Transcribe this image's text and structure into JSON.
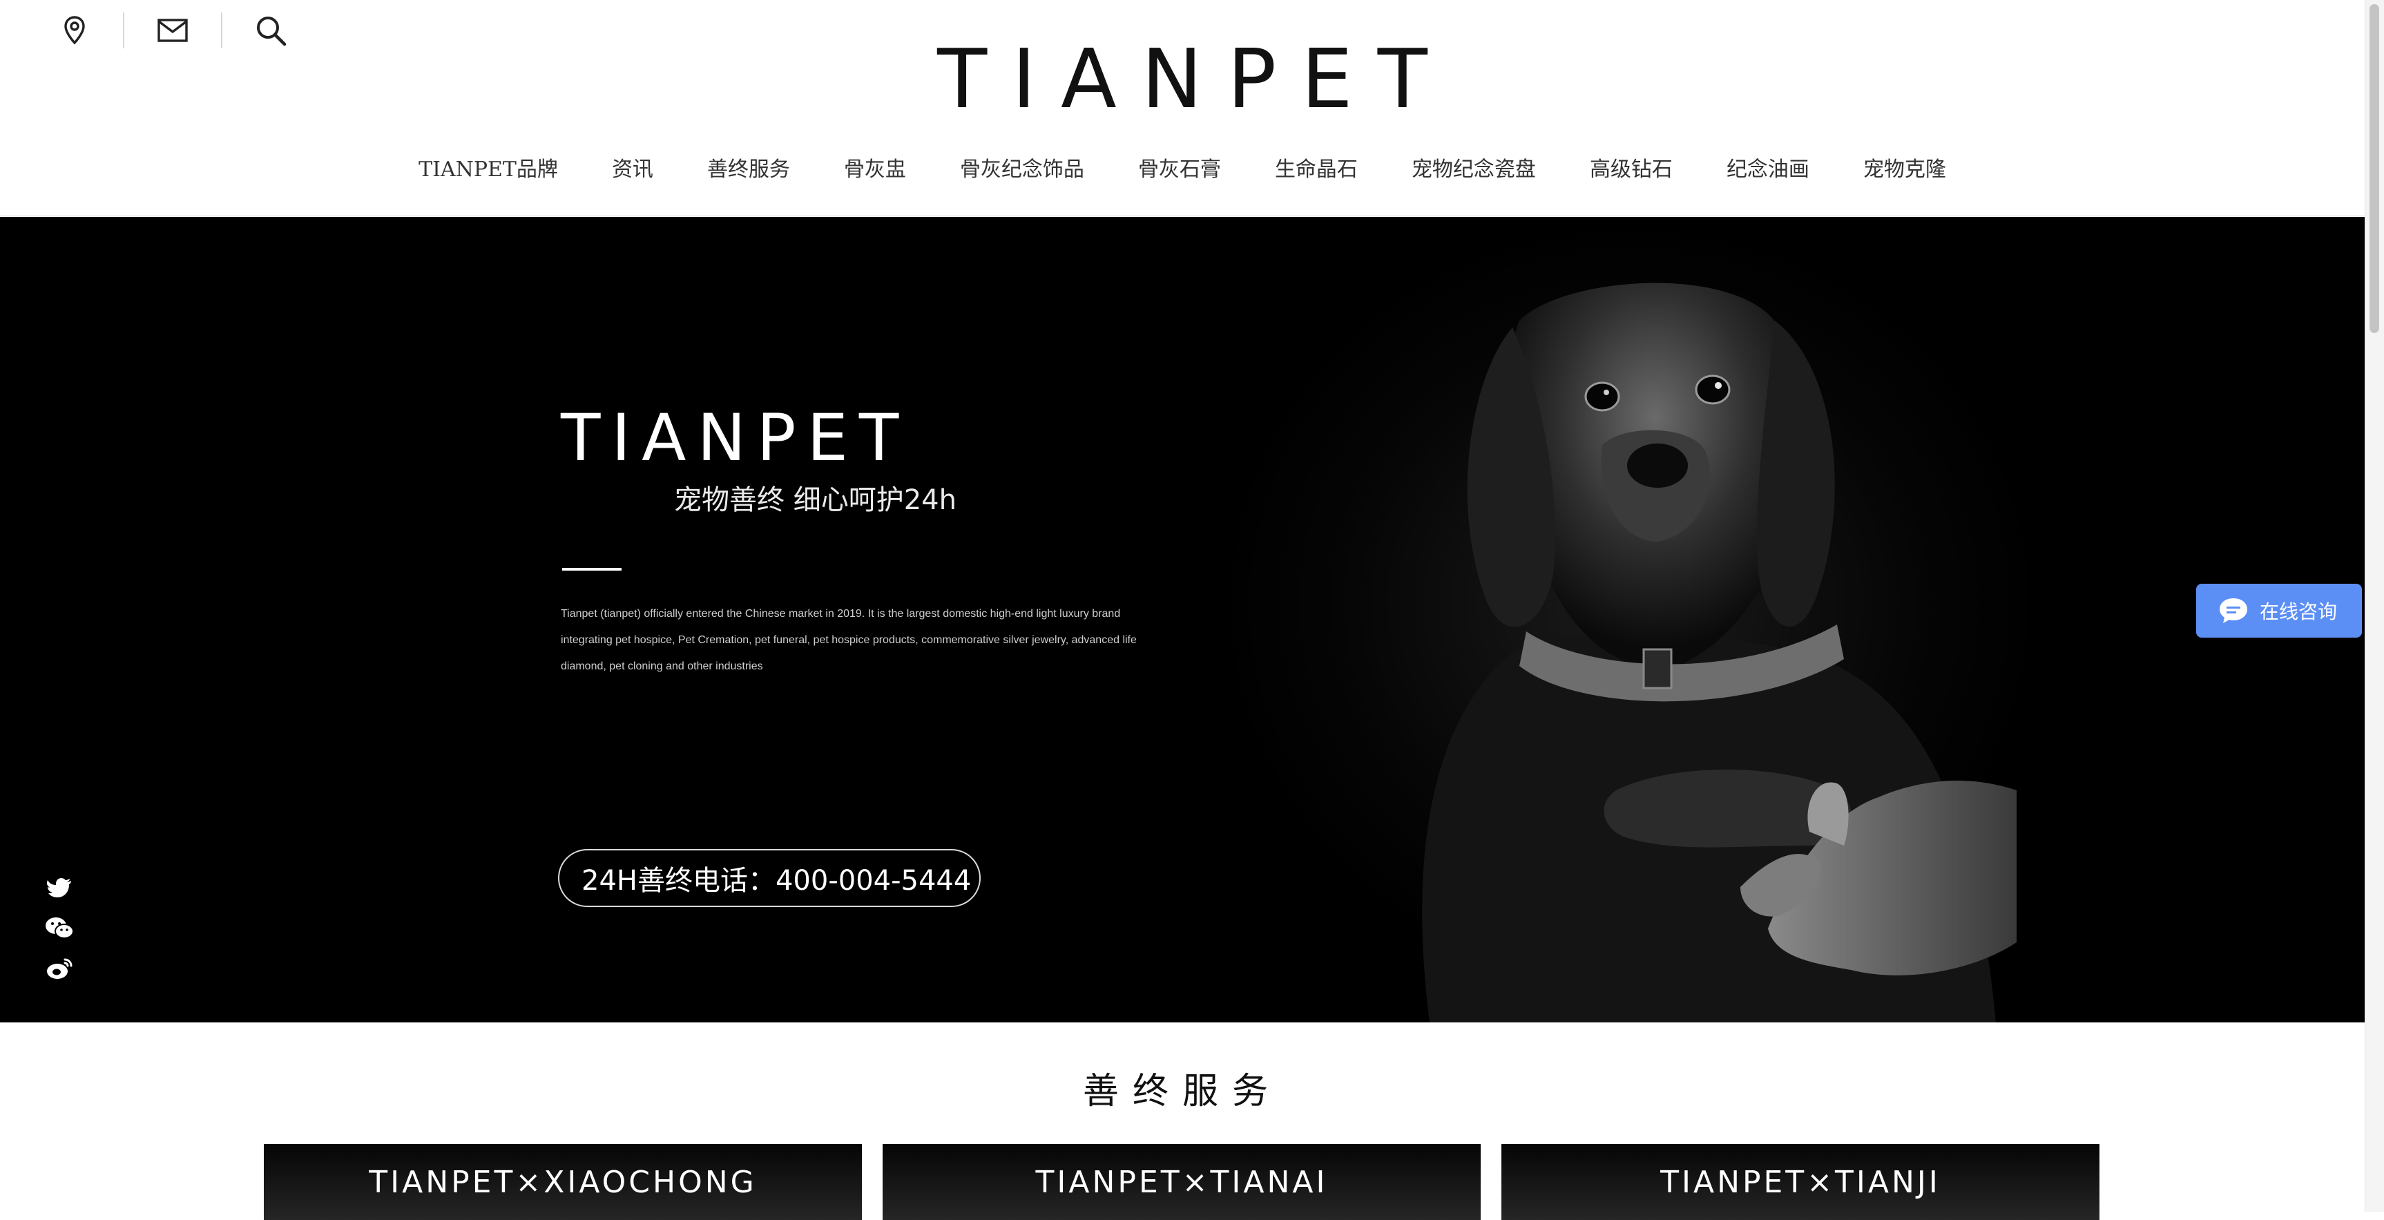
{
  "header": {
    "logo": "TIANPET",
    "icons": [
      "location-icon",
      "mail-icon",
      "search-icon"
    ],
    "nav": [
      "TIANPET品牌",
      "资讯",
      "善终服务",
      "骨灰盅",
      "骨灰纪念饰品",
      "骨灰石膏",
      "生命晶石",
      "宠物纪念瓷盘",
      "高级钻石",
      "纪念油画",
      "宠物克隆"
    ]
  },
  "hero": {
    "brand": "TIANPET",
    "tagline": "宠物善终 细心呵护24h",
    "description": "Tianpet (tianpet) officially entered the Chinese market in 2019. It is the largest domestic high-end light luxury brand integrating pet hospice, Pet Cremation, pet funeral, pet hospice products, commemorative silver jewelry, advanced life diamond, pet cloning and other industries",
    "phone": "24H善终电话：400-004-5444",
    "social_icons": [
      "twitter-icon",
      "wechat-icon",
      "weibo-icon"
    ]
  },
  "consult": {
    "label": "在线咨询",
    "color": "#5b8ff5"
  },
  "services": {
    "title": "善终服务",
    "cards": [
      "TIANPET×XIAOCHONG",
      "TIANPET×TIANAI",
      "TIANPET×TIANJI"
    ]
  }
}
